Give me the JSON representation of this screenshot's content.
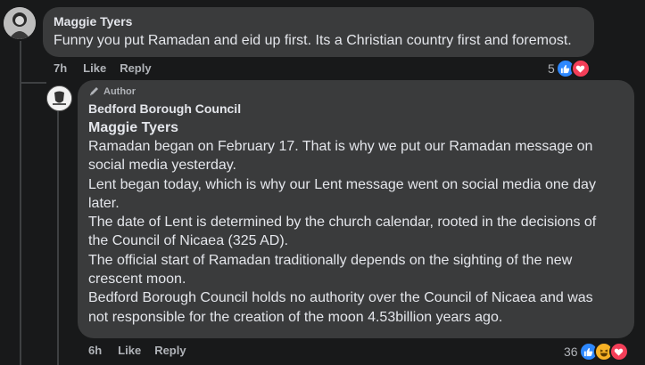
{
  "comment1": {
    "author": "Maggie Tyers",
    "text": "Funny you put Ramadan and eid up first. Its a Christian country first and foremost.",
    "time": "7h",
    "like_label": "Like",
    "reply_label": "Reply",
    "reaction_count": "5",
    "reaction_icons": [
      "like-icon",
      "love-icon"
    ]
  },
  "reply1": {
    "badge": "Author",
    "author": "Bedford Borough Council",
    "mention": "Maggie Tyers",
    "lines": [
      "Ramadan began on February 17. That is why we put our Ramadan message on",
      "social media yesterday.",
      "Lent began today, which is why our Lent message went on social media one day",
      "later.",
      "The date of Lent is determined by the church calendar, rooted in the decisions of",
      "the Council of Nicaea (325 AD).",
      "The official start of Ramadan traditionally depends on the sighting of the new",
      "crescent moon.",
      "Bedford Borough Council holds no authority over the Council of Nicaea and was",
      "not responsible for the creation of the moon 4.53billion years ago."
    ],
    "time": "6h",
    "like_label": "Like",
    "reply_label": "Reply",
    "reaction_count": "36",
    "reaction_icons": [
      "like-icon",
      "haha-icon",
      "love-icon"
    ]
  },
  "colors": {
    "like": "#2d88ff",
    "love": "#f33e58",
    "haha": "#f7b125"
  }
}
